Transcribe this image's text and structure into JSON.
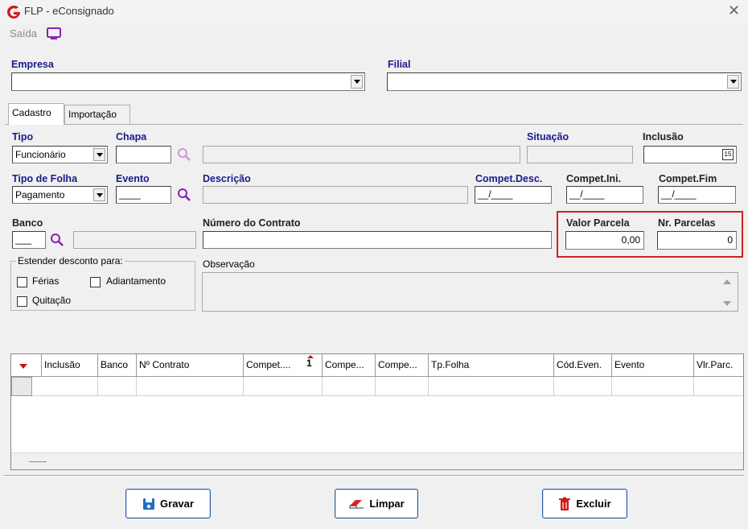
{
  "window": {
    "title": "FLP - eConsignado"
  },
  "menu": {
    "saida": "Saída"
  },
  "empresa": {
    "label": "Empresa",
    "value": ""
  },
  "filial": {
    "label": "Filial",
    "value": ""
  },
  "tabs": [
    {
      "label": "Cadastro",
      "active": true
    },
    {
      "label": "Importação",
      "active": false
    }
  ],
  "form": {
    "tipo": {
      "label": "Tipo",
      "value": "Funcionário"
    },
    "chapa": {
      "label": "Chapa",
      "value": ""
    },
    "situacao": {
      "label": "Situação",
      "value": ""
    },
    "inclusao": {
      "label": "Inclusão",
      "value": "",
      "calendar_glyph": "15"
    },
    "tipo_folha": {
      "label": "Tipo de Folha",
      "value": "Pagamento"
    },
    "evento": {
      "label": "Evento",
      "value": "____"
    },
    "descricao": {
      "label": "Descrição",
      "value": ""
    },
    "compet_desc": {
      "label": "Compet.Desc.",
      "value": "__/____"
    },
    "compet_ini": {
      "label": "Compet.Ini.",
      "value": "__/____"
    },
    "compet_fim": {
      "label": "Compet.Fim",
      "value": "__/____"
    },
    "banco": {
      "label": "Banco",
      "value": "___"
    },
    "numero_contrato": {
      "label": "Número do Contrato",
      "value": ""
    },
    "valor_parcela": {
      "label": "Valor Parcela",
      "value": "0,00"
    },
    "nr_parcelas": {
      "label": "Nr. Parcelas",
      "value": "0"
    },
    "estender": {
      "title": "Estender desconto para:",
      "ferias": "Férias",
      "adiantamento": "Adiantamento",
      "quitacao": "Quitação"
    },
    "observacao": {
      "label": "Observação",
      "value": ""
    }
  },
  "grid": {
    "sort_indicator": "1",
    "columns": [
      "Inclusão",
      "Banco",
      "Nº Contrato",
      "Compet....",
      "Compe...",
      "Compe...",
      "Tp.Folha",
      "Cód.Even.",
      "Evento",
      "Vlr.Parc."
    ]
  },
  "buttons": {
    "gravar": "Gravar",
    "limpar": "Limpar",
    "excluir": "Excluir"
  },
  "colors": {
    "label_blue": "#1a1a8c",
    "highlight_red": "#d12020",
    "search_purple": "#8a1fb8"
  }
}
